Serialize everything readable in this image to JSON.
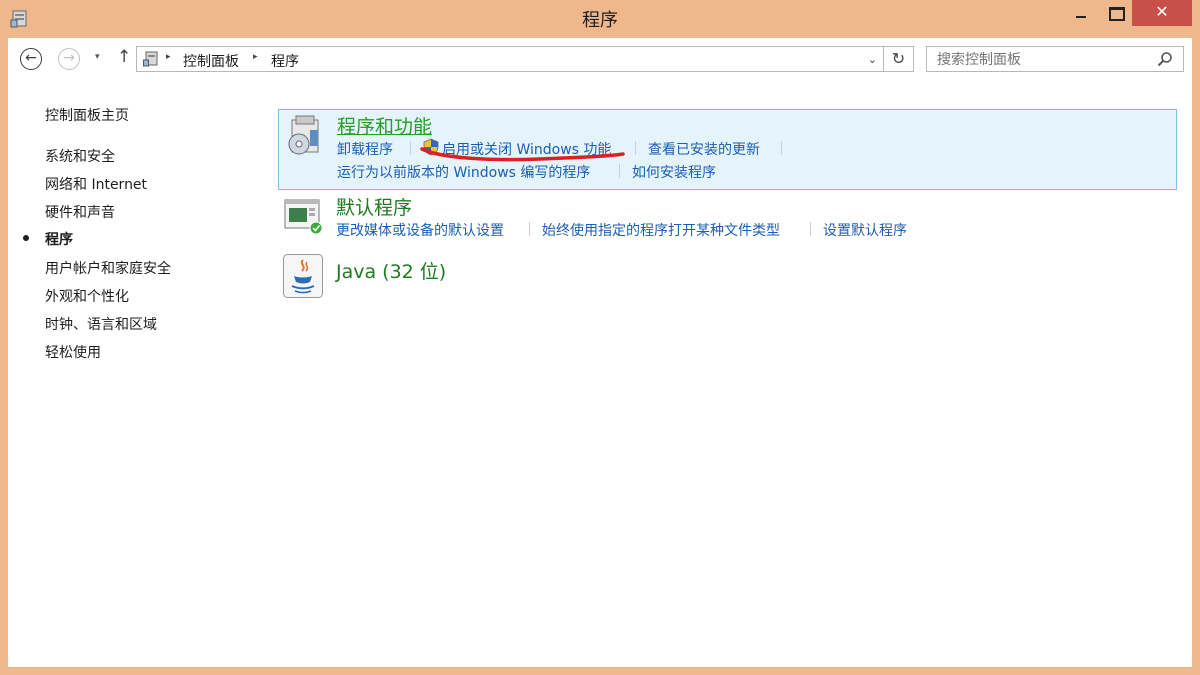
{
  "window": {
    "title": "程序"
  },
  "nav": {
    "back": "←",
    "forward": "→",
    "dropdown": "▾",
    "up": "↑",
    "breadcrumbs": [
      "控制面板",
      "程序"
    ],
    "crumb_separator": "▸",
    "addr_dropdown": "⌄",
    "refresh": "↻"
  },
  "search": {
    "placeholder": "搜索控制面板"
  },
  "window_buttons": {
    "close": "✕"
  },
  "sidebar": {
    "items": [
      {
        "label": "控制面板主页"
      },
      {
        "label": "系统和安全"
      },
      {
        "label": "网络和 Internet"
      },
      {
        "label": "硬件和声音"
      },
      {
        "label": "程序",
        "active": true
      },
      {
        "label": "用户帐户和家庭安全"
      },
      {
        "label": "外观和个性化"
      },
      {
        "label": "时钟、语言和区域"
      },
      {
        "label": "轻松使用"
      }
    ]
  },
  "categories": [
    {
      "title": "程序和功能",
      "icon": "programs-features-icon",
      "links": [
        "卸载程序",
        "启用或关闭 Windows 功能",
        "查看已安装的更新",
        "运行为以前版本的 Windows 编写的程序",
        "如何安装程序"
      ]
    },
    {
      "title": "默认程序",
      "icon": "default-programs-icon",
      "links": [
        "更改媒体或设备的默认设置",
        "始终使用指定的程序打开某种文件类型",
        "设置默认程序"
      ]
    },
    {
      "title": "Java (32 位)",
      "icon": "java-icon",
      "links": []
    }
  ],
  "colors": {
    "frame": "#efb88c",
    "link": "#1a5fb4",
    "category_title": "#1e7b1e",
    "highlight_bg": "#e5f3fb",
    "close_button": "#c7504a",
    "annotation": "#e02020"
  }
}
